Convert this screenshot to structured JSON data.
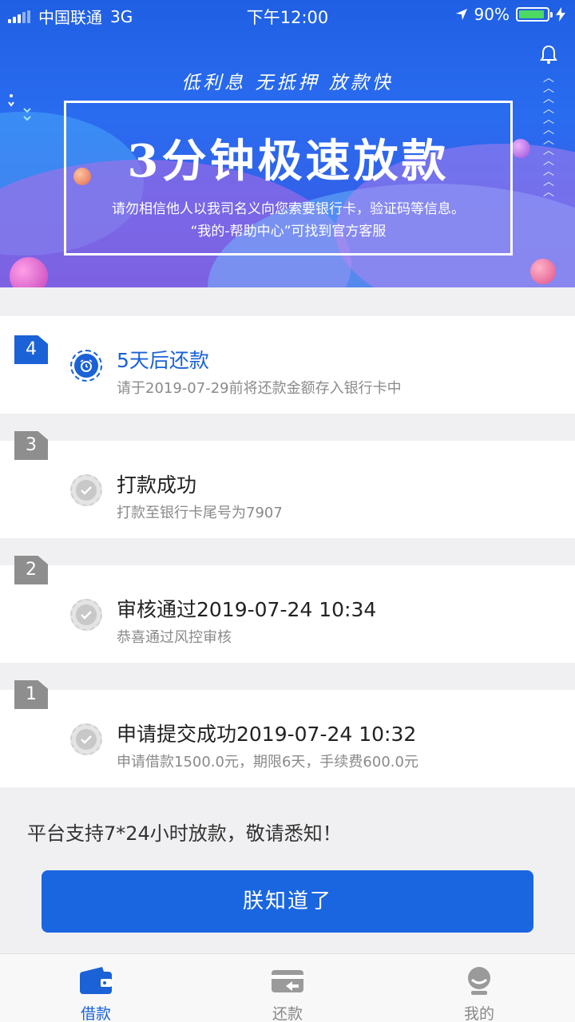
{
  "status_bar": {
    "carrier": "中国联通",
    "network": "3G",
    "time": "下午12:00",
    "battery": "90%",
    "battery_level": 0.9
  },
  "banner": {
    "tagline": "低利息 无抵押 放款快",
    "headline": "3分钟极速放款",
    "notice_line1": "请勿相信他人以我司名义向您索要银行卡，验证码等信息。",
    "notice_line2": "“我的-帮助中心”可找到官方客服"
  },
  "steps": [
    {
      "number": "4",
      "status": "active",
      "title": "5天后还款",
      "subtitle": "请于2019-07-29前将还款金额存入银行卡中",
      "icon": "alarm-clock-icon"
    },
    {
      "number": "3",
      "status": "done",
      "title": "打款成功",
      "subtitle": "打款至银行卡尾号为7907",
      "icon": "check-circle-icon"
    },
    {
      "number": "2",
      "status": "done",
      "title": "审核通过2019-07-24 10:34",
      "subtitle": "恭喜通过风控审核",
      "icon": "check-circle-icon"
    },
    {
      "number": "1",
      "status": "done",
      "title": "申请提交成功2019-07-24 10:32",
      "subtitle": "申请借款1500.0元，期限6天，手续费600.0元",
      "icon": "check-circle-icon"
    }
  ],
  "support_text": "平台支持7*24小时放款，敬请悉知！",
  "confirm_button": "朕知道了",
  "tabbar": {
    "items": [
      {
        "label": "借款",
        "icon": "wallet-icon",
        "active": true
      },
      {
        "label": "还款",
        "icon": "repay-card-icon",
        "active": false
      },
      {
        "label": "我的",
        "icon": "user-icon",
        "active": false
      }
    ]
  },
  "colors": {
    "primary": "#1a62d6",
    "banner_blue": "#2a6cf0",
    "inactive": "#8e8e8e"
  }
}
